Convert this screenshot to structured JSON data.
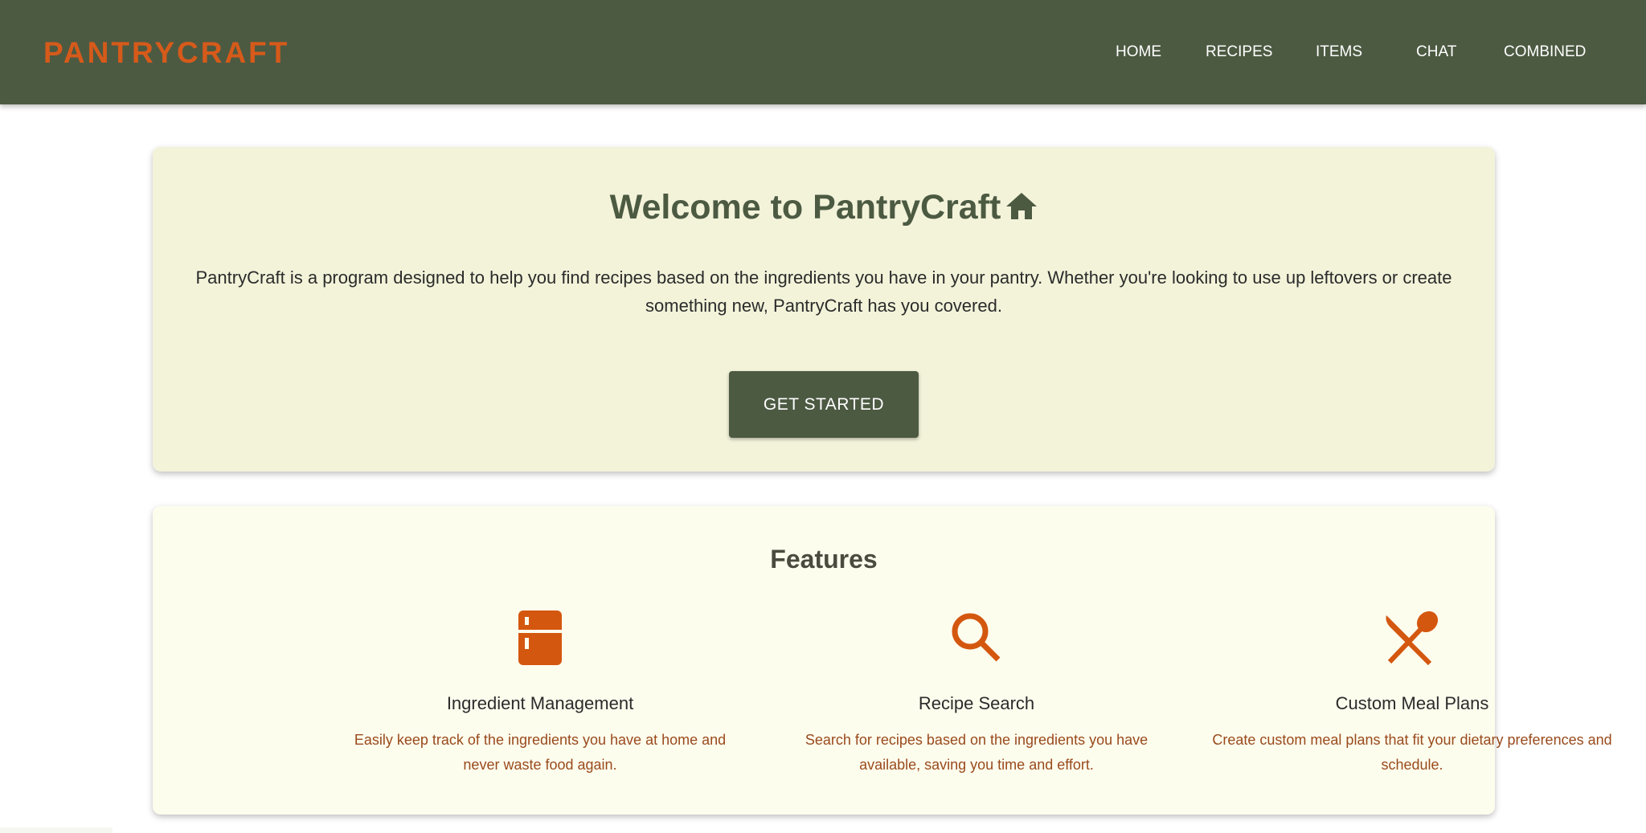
{
  "colors": {
    "header_bg": "#4c5a42",
    "brand": "#d65a1a",
    "accent_icon": "#d4570f",
    "welcome_card_bg": "#f3f3da",
    "features_card_bg": "#fdfdee",
    "feature_desc": "#9a4a1c"
  },
  "header": {
    "brand": "PANTRYCRAFT",
    "nav": [
      "HOME",
      "RECIPES",
      "ITEMS",
      "CHAT",
      "COMBINED"
    ]
  },
  "welcome": {
    "title": "Welcome to PantryCraft",
    "title_icon": "home-icon",
    "text": "PantryCraft is a program designed to help you find recipes based on the ingredients you have in your pantry. Whether you're looking to use up leftovers or create something new, PantryCraft has you covered.",
    "button": "GET STARTED"
  },
  "features": {
    "title": "Features",
    "items": [
      {
        "icon": "kitchen-fridge-icon",
        "title": "Ingredient Management",
        "desc": "Easily keep track of the ingredients you have at home and never waste food again."
      },
      {
        "icon": "search-icon",
        "title": "Recipe Search",
        "desc": "Search for recipes based on the ingredients you have available, saving you time and effort."
      },
      {
        "icon": "restaurant-utensils-icon",
        "title": "Custom Meal Plans",
        "desc": "Create custom meal plans that fit your dietary preferences and schedule."
      }
    ]
  }
}
